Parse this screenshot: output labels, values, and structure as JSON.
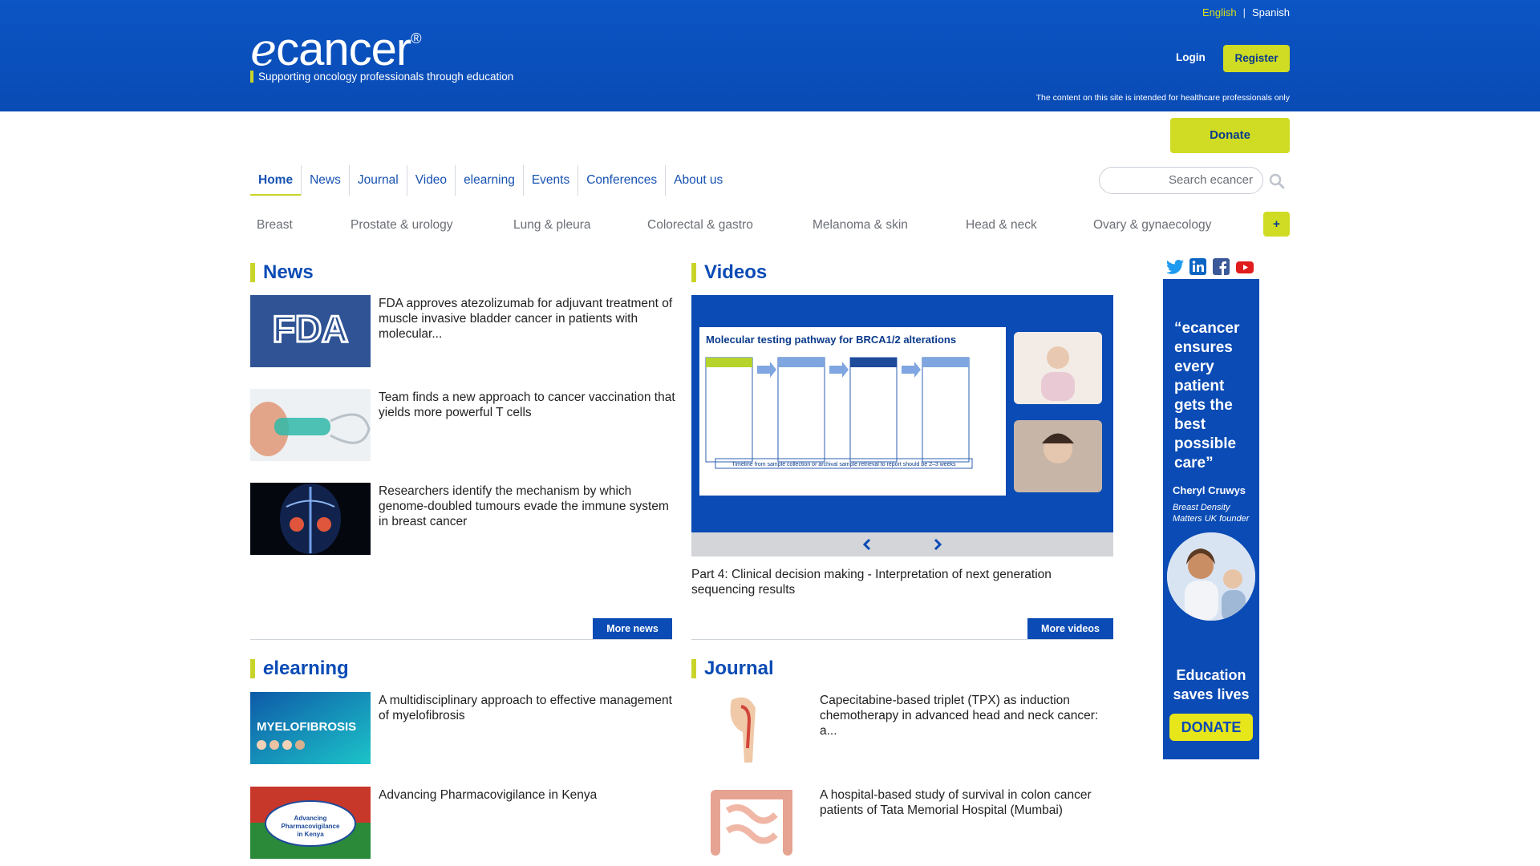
{
  "brand": {
    "logo_prefix": "e",
    "logo_text": "cancer",
    "registered": "®",
    "tagline": "Supporting oncology professionals through education"
  },
  "lang": {
    "english": "English",
    "separator": "|",
    "spanish": "Spanish"
  },
  "auth": {
    "login": "Login",
    "register": "Register"
  },
  "disclaimer": "The content on this site is intended for healthcare professionals only",
  "donate": "Donate",
  "nav": [
    "Home",
    "News",
    "Journal",
    "Video",
    "elearning",
    "Events",
    "Conferences",
    "About us"
  ],
  "search": {
    "placeholder": "Search ecancer"
  },
  "categories": [
    "Breast",
    "Prostate & urology",
    "Lung & pleura",
    "Colorectal & gastro",
    "Melanoma & skin",
    "Head & neck",
    "Ovary & gynaecology"
  ],
  "categories_more": "+",
  "news": {
    "title": "News",
    "items": [
      {
        "text": "FDA approves atezolizumab for adjuvant treatment of muscle invasive bladder cancer in patients with molecular...",
        "thumb_label": "FDA"
      },
      {
        "text": "Team finds a new approach to cancer vaccination that yields more powerful T cells"
      },
      {
        "text": "Researchers identify the mechanism by which genome-doubled tumours evade the immune system in breast cancer"
      }
    ],
    "more": "More news +"
  },
  "videos": {
    "title": "Videos",
    "slide_title": "Molecular testing pathway for BRCA1/2 alterations",
    "slide_footer": "Timeline from sample collection or archival sample retrieval to report should be 2–3 weeks",
    "caption": "Part 4: Clinical decision making - Interpretation of next generation sequencing results",
    "more": "More videos +"
  },
  "elearning": {
    "title_prefix": "e",
    "title_rest": "learning",
    "items": [
      {
        "text": "A multidisciplinary approach to effective management of myelofibrosis",
        "thumb_label": "MYELOFIBROSIS"
      },
      {
        "text": "Advancing Pharmacovigilance in Kenya",
        "thumb_label": "Advancing Pharmacovigilance in Kenya"
      }
    ]
  },
  "journal": {
    "title": "Journal",
    "items": [
      {
        "text": "Capecitabine-based triplet (TPX) as induction chemotherapy in advanced head and neck cancer: a..."
      },
      {
        "text": "A hospital-based study of survival in colon cancer patients of Tata Memorial Hospital (Mumbai)"
      }
    ]
  },
  "ad": {
    "quote": "“ecancer ensures every patient gets the best possible care”",
    "name": "Cheryl Cruwys",
    "role": "Breast Density Matters UK founder",
    "slogan": "Education saves lives",
    "button": "DONATE"
  },
  "social": [
    "twitter-icon",
    "linkedin-icon",
    "facebook-icon",
    "youtube-icon"
  ],
  "colors": {
    "brand_blue": "#0a4bb5",
    "accent_yellow": "#cfdc23"
  }
}
